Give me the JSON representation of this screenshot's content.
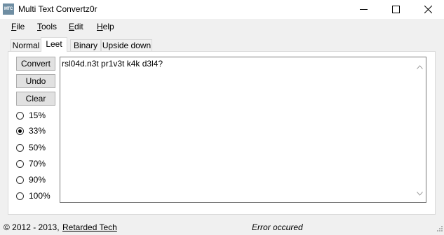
{
  "window": {
    "title": "Multi Text Convertz0r",
    "icon_text": "MTC"
  },
  "menu": [
    {
      "accel": "F",
      "rest": "ile"
    },
    {
      "accel": "T",
      "rest": "ools"
    },
    {
      "accel": "E",
      "rest": "dit"
    },
    {
      "accel": "H",
      "rest": "elp"
    }
  ],
  "tabs": [
    {
      "label": "Normal",
      "active": false
    },
    {
      "label": "Leet",
      "active": true
    },
    {
      "label": "Binary",
      "active": false
    },
    {
      "label": "Upside down",
      "active": false
    }
  ],
  "buttons": {
    "convert": "Convert",
    "undo": "Undo",
    "clear": "Clear"
  },
  "radios": [
    {
      "label": "15%",
      "checked": false
    },
    {
      "label": "33%",
      "checked": true
    },
    {
      "label": "50%",
      "checked": false
    },
    {
      "label": "70%",
      "checked": false
    },
    {
      "label": "90%",
      "checked": false
    },
    {
      "label": "100%",
      "checked": false
    }
  ],
  "textbox": {
    "value": "rsl04d.n3t pr1v3t k4k d3l4?"
  },
  "status": {
    "copyright": "© 2012 - 2013,",
    "company": "Retarded Tech",
    "message": "Error occured"
  }
}
